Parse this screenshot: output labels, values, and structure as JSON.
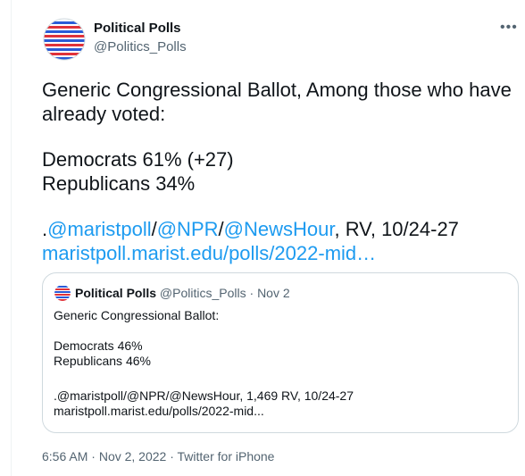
{
  "author": {
    "name": "Political Polls",
    "handle": "@Politics_Polls"
  },
  "tweet": {
    "line1": "Generic Congressional Ballot, Among those who have",
    "line2": "already voted:",
    "dem": "Democrats 61% (+27)",
    "rep": "Republicans 34%",
    "src_prefix": ".",
    "mention1": "@maristpoll",
    "slash1": "/",
    "mention2": "@NPR",
    "slash2": "/",
    "mention3": "@NewsHour",
    "src_suffix": ", RV, 10/24-27",
    "url": "maristpoll.marist.edu/polls/2022-mid…"
  },
  "quote": {
    "name": "Political Polls",
    "handle": "@Politics_Polls",
    "sep": " · ",
    "date": "Nov 2",
    "line1": "Generic Congressional Ballot:",
    "dem": "Democrats 46%",
    "rep": "Republicans 46%",
    "source": ".@maristpoll/@NPR/@NewsHour, 1,469 RV, 10/24-27",
    "url": "maristpoll.marist.edu/polls/2022-mid..."
  },
  "footer": {
    "time": "6:56 AM",
    "sep1": " · ",
    "date": "Nov 2, 2022",
    "sep2": " · ",
    "client": "Twitter for iPhone"
  },
  "icons": {
    "more": "more-icon",
    "avatar": "political-polls-logo"
  },
  "colors": {
    "link": "#1d9bf0",
    "muted": "#536471",
    "red": "#e0323a",
    "blue": "#2a5bd7"
  }
}
